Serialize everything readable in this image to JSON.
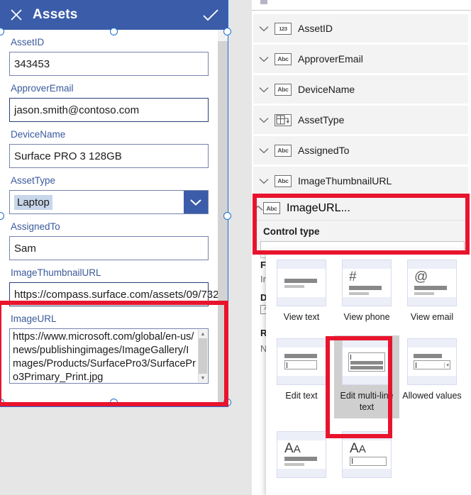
{
  "form": {
    "title": "Assets",
    "close_icon": "close-x-icon",
    "accept_icon": "checkmark-icon",
    "fields": [
      {
        "label": "AssetID",
        "value": "343453",
        "type": "text"
      },
      {
        "label": "ApproverEmail",
        "value": "jason.smith@contoso.com",
        "type": "text"
      },
      {
        "label": "DeviceName",
        "value": "Surface PRO 3 128GB",
        "type": "text"
      },
      {
        "label": "AssetType",
        "value": "Laptop",
        "type": "dropdown"
      },
      {
        "label": "AssignedTo",
        "value": "Sam",
        "type": "text"
      },
      {
        "label": "ImageThumbnailURL",
        "value": "https://compass.surface.com/assets/09/732",
        "type": "text"
      },
      {
        "label": "ImageURL",
        "value": "https://www.microsoft.com/global/en-us/news/publishingimages/ImageGallery/Images/Products/SurfacePro3/SurfacePro3Primary_Print.jpg",
        "type": "multiline"
      }
    ]
  },
  "panel": {
    "fields": [
      {
        "name": "AssetID",
        "icon": "123",
        "icon_name": "number-type-icon",
        "chevron": "chevron-down-icon"
      },
      {
        "name": "ApproverEmail",
        "icon": "Abc",
        "icon_name": "text-type-icon",
        "chevron": "chevron-down-icon"
      },
      {
        "name": "DeviceName",
        "icon": "Abc",
        "icon_name": "text-type-icon",
        "chevron": "chevron-down-icon"
      },
      {
        "name": "AssetType",
        "icon": "grid",
        "icon_name": "choice-type-icon",
        "chevron": "chevron-down-icon"
      },
      {
        "name": "AssignedTo",
        "icon": "Abc",
        "icon_name": "text-type-icon",
        "chevron": "chevron-down-icon"
      },
      {
        "name": "ImageThumbnailURL",
        "icon": "Abc",
        "icon_name": "text-type-icon",
        "chevron": "chevron-down-icon"
      }
    ],
    "expanded": {
      "name": "ImageURL",
      "icon": "Abc",
      "chevron": "chevron-up-icon",
      "overflow": "...",
      "control_type_label": "Control type",
      "control_type_value": ""
    },
    "hidden_properties": [
      {
        "text": "Fi",
        "bold": true
      },
      {
        "text": "In",
        "bold": false
      },
      {
        "text": "D",
        "bold": true
      },
      {
        "text": "Ab",
        "bold": false
      },
      {
        "text": "R",
        "bold": true
      },
      {
        "text": "N",
        "bold": false
      }
    ]
  },
  "flyout": {
    "items": [
      {
        "label": "View text",
        "selected": false,
        "thumb": "text-lines"
      },
      {
        "label": "View phone",
        "selected": false,
        "thumb": "hash"
      },
      {
        "label": "View email",
        "selected": false,
        "thumb": "at"
      },
      {
        "label": "Edit text",
        "selected": false,
        "thumb": "label-input"
      },
      {
        "label": "Edit multi-line text",
        "selected": true,
        "thumb": "multiline-input"
      },
      {
        "label": "Allowed values",
        "selected": false,
        "thumb": "label-dropdown"
      },
      {
        "label": "",
        "selected": false,
        "thumb": "aa-lines"
      },
      {
        "label": "",
        "selected": false,
        "thumb": "aa-input"
      }
    ]
  },
  "colors": {
    "header_blue": "#3b5ca8",
    "label_blue": "#3a5a9b",
    "annotation_red": "#e8142d",
    "selection_blue": "#1f6fd0",
    "field_card_gray": "#f3f3f3",
    "selected_tile_gray": "#cfcfcf"
  }
}
